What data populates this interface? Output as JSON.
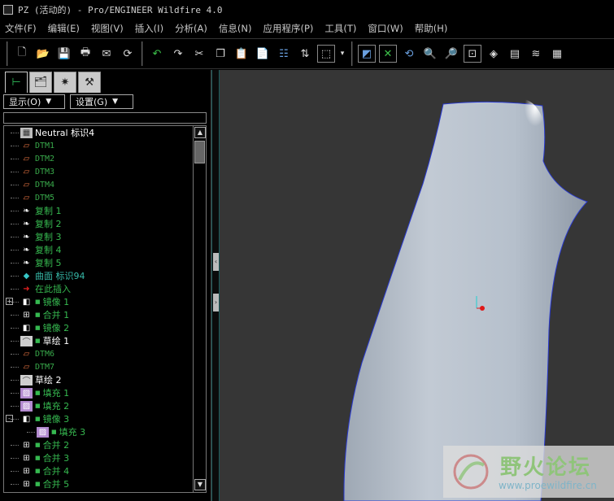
{
  "window": {
    "title": "PZ (活动的) - Pro/ENGINEER Wildfire 4.0"
  },
  "menu": [
    "文件(F)",
    "编辑(E)",
    "视图(V)",
    "插入(I)",
    "分析(A)",
    "信息(N)",
    "应用程序(P)",
    "工具(T)",
    "窗口(W)",
    "帮助(H)"
  ],
  "toolbar": {
    "icons": [
      "new-icon",
      "open-icon",
      "save-icon",
      "print-icon",
      "send-icon",
      "regenerate-icon",
      "undo-icon",
      "redo-icon",
      "cut-icon",
      "copy-icon",
      "paste-icon",
      "paste-special-icon",
      "model-tree-settings-icon",
      "bom-icon",
      "select-box-icon",
      "dropdown-icon",
      "repaint-icon",
      "spin-center-icon",
      "orient-icon",
      "zoom-in-icon",
      "zoom-out-icon",
      "refit-icon",
      "reorient-icon",
      "saved-views-icon",
      "layers-icon",
      "view-manager-icon"
    ]
  },
  "panel": {
    "show_label": "显示(O)",
    "settings_label": "设置(G)",
    "tabs": [
      "model-tree-tab",
      "folder-browser-tab",
      "favorites-tab",
      "connections-tab"
    ]
  },
  "tree": [
    {
      "label": "Neutral 标识4",
      "type": "root",
      "color": "white"
    },
    {
      "label": "DTM1",
      "type": "plane",
      "color": "dtm"
    },
    {
      "label": "DTM2",
      "type": "plane",
      "color": "dtm"
    },
    {
      "label": "DTM3",
      "type": "plane",
      "color": "dtm"
    },
    {
      "label": "DTM4",
      "type": "plane",
      "color": "dtm"
    },
    {
      "label": "DTM5",
      "type": "plane",
      "color": "dtm"
    },
    {
      "label": "复制 1",
      "type": "copy",
      "color": "green"
    },
    {
      "label": "复制 2",
      "type": "copy",
      "color": "green"
    },
    {
      "label": "复制 3",
      "type": "copy",
      "color": "green"
    },
    {
      "label": "复制 4",
      "type": "copy",
      "color": "green"
    },
    {
      "label": "复制 5",
      "type": "copy",
      "color": "green"
    },
    {
      "label": "曲面 标识94",
      "type": "surf",
      "color": "green"
    },
    {
      "label": "在此插入",
      "type": "insert",
      "color": "green"
    },
    {
      "label": "镜像 1",
      "type": "mirror",
      "color": "green",
      "expander": "+",
      "marker": true
    },
    {
      "label": "合并 1",
      "type": "merge",
      "color": "green",
      "marker": true
    },
    {
      "label": "镜像 2",
      "type": "mirror",
      "color": "green",
      "marker": true
    },
    {
      "label": "草绘 1",
      "type": "sketch",
      "color": "white",
      "marker": true
    },
    {
      "label": "DTM6",
      "type": "plane",
      "color": "dtm"
    },
    {
      "label": "DTM7",
      "type": "plane",
      "color": "dtm"
    },
    {
      "label": "草绘 2",
      "type": "sketch",
      "color": "white"
    },
    {
      "label": "填充 1",
      "type": "fill",
      "color": "green",
      "marker": true
    },
    {
      "label": "填充 2",
      "type": "fill",
      "color": "green",
      "marker": true
    },
    {
      "label": "镜像 3",
      "type": "mirror",
      "color": "green",
      "expander": "-",
      "marker": true
    },
    {
      "label": "填充 3",
      "type": "fill",
      "color": "green",
      "marker": true,
      "indent": 1
    },
    {
      "label": "合并 2",
      "type": "merge",
      "color": "green",
      "marker": true
    },
    {
      "label": "合并 3",
      "type": "merge",
      "color": "green",
      "marker": true
    },
    {
      "label": "合并 4",
      "type": "merge",
      "color": "green",
      "marker": true
    },
    {
      "label": "合并 5",
      "type": "merge",
      "color": "green",
      "marker": true
    }
  ],
  "watermark": {
    "title": "野火论坛",
    "url": "www.proewildfire.cn"
  }
}
